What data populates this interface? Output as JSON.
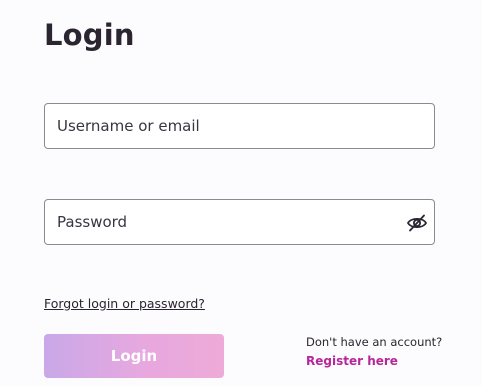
{
  "form": {
    "title": "Login",
    "username": {
      "placeholder": "Username or email",
      "value": ""
    },
    "password": {
      "placeholder": "Password",
      "value": "",
      "toggle_icon": "eye-slash-icon"
    },
    "forgot_link": "Forgot login or password?",
    "submit_label": "Login",
    "register_prompt": "Don't have an account?",
    "register_link": "Register here"
  },
  "colors": {
    "text": "#2a2531",
    "field_border": "#8f8797",
    "button_gradient_start": "#c9a8e8",
    "button_gradient_end": "#eeaad8",
    "link_accent": "#b5289a"
  }
}
